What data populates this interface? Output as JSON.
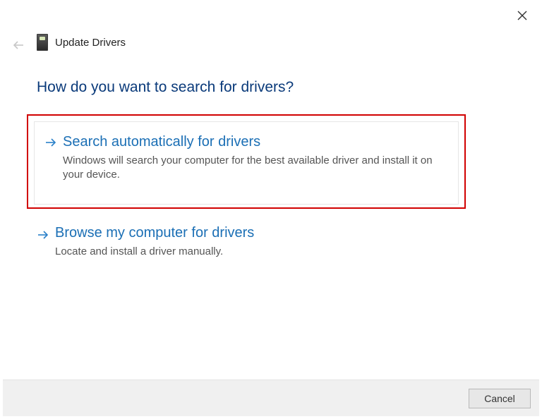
{
  "header": {
    "title": "Update Drivers"
  },
  "question": "How do you want to search for drivers?",
  "options": [
    {
      "title": "Search automatically for drivers",
      "description": "Windows will search your computer for the best available driver and install it on your device."
    },
    {
      "title": "Browse my computer for drivers",
      "description": "Locate and install a driver manually."
    }
  ],
  "footer": {
    "cancel_label": "Cancel"
  }
}
